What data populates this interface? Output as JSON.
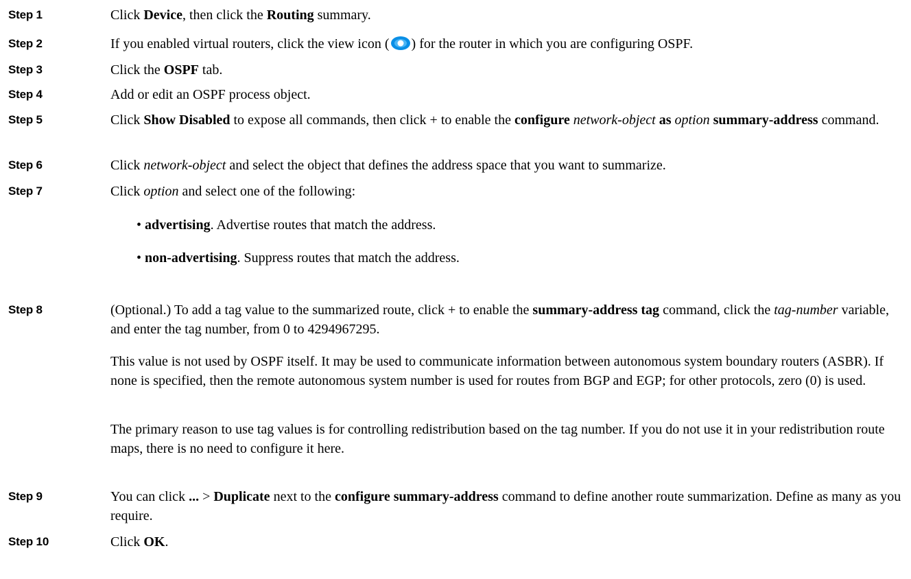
{
  "steps": [
    {
      "label": "Step 1",
      "parts": [
        "Click ",
        "Device",
        ", then click the ",
        "Routing",
        " summary."
      ]
    },
    {
      "label": "Step 2",
      "parts": [
        "If you enabled virtual routers, click the view icon (",
        ") for the router in which you are configuring OSPF."
      ],
      "icon": "eye-icon"
    },
    {
      "label": "Step 3",
      "parts": [
        "Click the ",
        "OSPF",
        " tab."
      ]
    },
    {
      "label": "Step 4",
      "parts": [
        "Add or edit an OSPF process object."
      ]
    },
    {
      "label": "Step 5",
      "parts": [
        "Click ",
        "Show Disabled",
        " to expose all commands, then click + to enable the ",
        "configure",
        " ",
        "network-object",
        " ",
        "as",
        " ",
        "option",
        " ",
        "summary-address",
        " command."
      ]
    },
    {
      "label": "Step 6",
      "parts": [
        "Click ",
        "network-object",
        " and select the object that defines the address space that you want to summarize."
      ]
    },
    {
      "label": "Step 7",
      "parts": [
        "Click ",
        "option",
        " and select one of the following:"
      ],
      "bullets": [
        {
          "term": "advertising",
          "text": ". Advertise routes that match the address."
        },
        {
          "term": "non-advertising",
          "text": ". Suppress routes that match the address."
        }
      ]
    },
    {
      "label": "Step 8",
      "parts": [
        "(Optional.) To add a tag value to the summarized route, click + to enable the ",
        "summary-address tag",
        " command, click the ",
        "tag-number",
        " variable, and enter the tag number, from 0 to 4294967295."
      ],
      "paragraphs": [
        "This value is not used by OSPF itself. It may be used to communicate information between autonomous system boundary routers (ASBR). If none is specified, then the remote autonomous system number is used for routes from BGP and EGP; for other protocols, zero (0) is used.",
        "The primary reason to use tag values is for controlling redistribution based on the tag number. If you do not use it in your redistribution route maps, there is no need to configure it here."
      ]
    },
    {
      "label": "Step 9",
      "parts": [
        "You can click ",
        "...",
        " > ",
        "Duplicate",
        " next to the ",
        "configure summary-address",
        " command to define another route summarization. Define as many as you require."
      ]
    },
    {
      "label": "Step 10",
      "parts": [
        "Click ",
        "OK",
        "."
      ]
    }
  ],
  "colors": {
    "icon_blue": "#0a8fe6",
    "text": "#000000"
  }
}
